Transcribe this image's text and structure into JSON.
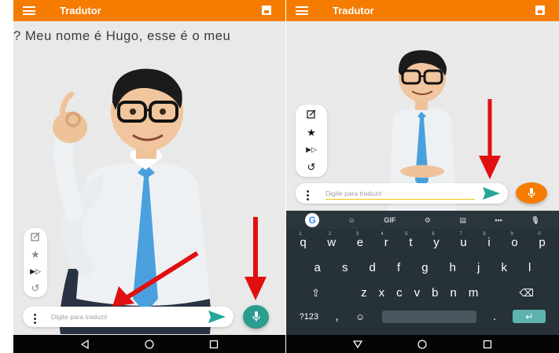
{
  "colors": {
    "appbar": "#f57c00",
    "mic_left": "#2a9d8f",
    "mic_right": "#f57c00",
    "send": "#26a69a",
    "keyboard_bg": "#263238",
    "arrow": "#e01010"
  },
  "left": {
    "appbar": {
      "title": "Tradutor"
    },
    "caption": "? Meu nome é Hugo, esse é o meu",
    "input": {
      "placeholder": "Digite para traduzir"
    }
  },
  "right": {
    "appbar": {
      "title": "Tradutor"
    },
    "input": {
      "placeholder": "Digite para traduzir"
    },
    "keyboard": {
      "toolbar": {
        "gif_label": "GIF"
      },
      "row1": [
        {
          "k": "q",
          "h": "1"
        },
        {
          "k": "w",
          "h": "2"
        },
        {
          "k": "e",
          "h": "3"
        },
        {
          "k": "r",
          "h": "4"
        },
        {
          "k": "t",
          "h": "5"
        },
        {
          "k": "y",
          "h": "6"
        },
        {
          "k": "u",
          "h": "7"
        },
        {
          "k": "i",
          "h": "8"
        },
        {
          "k": "o",
          "h": "9"
        },
        {
          "k": "p",
          "h": "0"
        }
      ],
      "row2": [
        "a",
        "s",
        "d",
        "f",
        "g",
        "h",
        "j",
        "k",
        "l"
      ],
      "row3": [
        "z",
        "x",
        "c",
        "v",
        "b",
        "n",
        "m"
      ],
      "row4": {
        "symbols_label": "?123",
        "comma": ",",
        "period": "."
      }
    }
  }
}
